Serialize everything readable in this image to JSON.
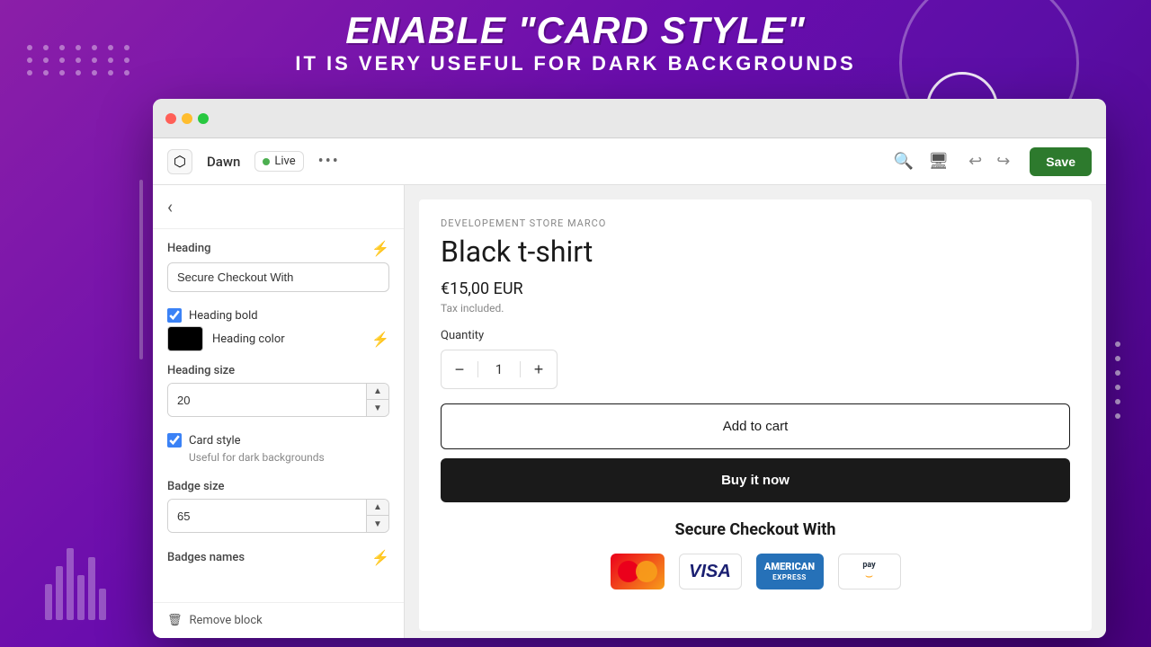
{
  "banner": {
    "line1": "Enable \"Card style\"",
    "line2": "It is very useful for dark backgrounds"
  },
  "toolbar": {
    "store_name": "Dawn",
    "live_label": "Live",
    "more_icon": "•••",
    "save_label": "Save"
  },
  "sidebar": {
    "back_label": "‹",
    "heading_label": "Heading",
    "heading_value": "Secure Checkout With",
    "heading_bold_label": "Heading bold",
    "heading_bold_checked": true,
    "heading_color_label": "Heading color",
    "heading_size_label": "Heading size",
    "heading_size_value": "20",
    "card_style_label": "Card style",
    "card_style_checked": true,
    "card_style_sub": "Useful for dark backgrounds",
    "badge_size_label": "Badge size",
    "badge_size_value": "65",
    "badges_names_label": "Badges names",
    "remove_block_label": "Remove block"
  },
  "preview": {
    "store_label": "DEVELOPEMENT STORE MARCO",
    "product_title": "Black t-shirt",
    "price": "€15,00 EUR",
    "price_note": "Tax included.",
    "quantity_label": "Quantity",
    "quantity_value": "1",
    "add_to_cart_label": "Add to cart",
    "buy_now_label": "Buy it now",
    "secure_checkout_title": "Secure Checkout With"
  },
  "payment_badges": [
    {
      "name": "mastercard",
      "label": "mastercard"
    },
    {
      "name": "visa",
      "label": "VISA"
    },
    {
      "name": "amex",
      "label": "AMERICAN EXPRESS"
    },
    {
      "name": "amazon-pay",
      "label": "pay"
    }
  ]
}
